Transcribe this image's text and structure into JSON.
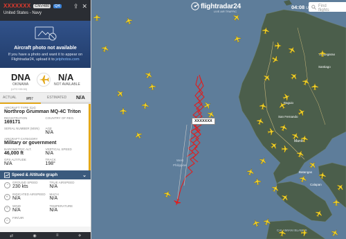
{
  "panel": {
    "callsign": "XXXXXXX",
    "badge_reg": "CNV480",
    "badge_icao": "Q4",
    "airline": "United States - Navy",
    "photo_title": "Aircraft photo not available",
    "photo_text": "If you have a photo and want it to appear on Flightradar24, upload it to",
    "photo_link": "jetphotos.com",
    "origin_code": "DNA",
    "origin_city": "OKINAWA",
    "origin_time": "(UTC+09:00)",
    "dest_code": "N/A",
    "dest_city": "NOT AVAILABLE",
    "actual_label": "ACTUAL",
    "actual_time": "2:37",
    "actual_unit": "am",
    "estimated_label": "ESTIMATED",
    "estimated_value": "N/A",
    "progress": 0.45,
    "aircraft_type_label": "AIRCRAFT TYPE (Q4)",
    "aircraft_type": "Northrop Grumman MQ-4C Triton",
    "registration_label": "REGISTRATION",
    "registration": "169171",
    "country_label": "COUNTRY OF REG.",
    "country_value": "",
    "serial_label": "SERIAL NUMBER (MSN)",
    "serial_value": "",
    "age_label": "AGE",
    "age_value": "N/A",
    "category_label": "AIRCRAFT CATEGORY",
    "category": "Military or government",
    "baro_label": "BAROMETRIC ALT.",
    "baro_value": "46,000 ft",
    "vspeed_label": "VERTICAL SPEED",
    "vspeed_value": "N/A",
    "gps_label": "GPS ALTITUDE",
    "gps_value": "N/A",
    "track_label": "TRACK",
    "track_value": "198°",
    "graph_button": "Speed & Altitude graph",
    "ground_speed_label": "GROUND SPEED",
    "ground_speed": "230 kts",
    "true_airspeed_label": "TRUE AIRSPEED",
    "true_airspeed": "N/A",
    "indicated_label": "INDICATED AIRSPEED",
    "indicated_value": "N/A",
    "mach_label": "MACH",
    "mach_value": "N/A",
    "wind_label": "WIND",
    "wind_value": "N/A",
    "temperature_label": "TEMPERATURE",
    "temperature_value": "N/A",
    "fir_label": "FIR/UIR"
  },
  "header": {
    "logo_name": "flightradar",
    "logo_num": "24",
    "logo_tag": "LIVE AIR TRAFFIC",
    "clock": "04:08",
    "clock_zone": "UTC",
    "search_placeholder": "Find flights"
  },
  "map": {
    "selected_label": "XXXXXXX",
    "places": [
      "Tuguegarao",
      "Santiago",
      "San Fernando",
      "Baguio",
      "Manila",
      "Batangas",
      "Calapan",
      "West Philippine Sea",
      "CALAMIAN ISLANDS"
    ]
  },
  "colors": {
    "sea": "#5e7d9a",
    "land": "#4a5c4a",
    "track": "#e01e1e",
    "aircraft": "#f2d22a",
    "accent": "#e3a81a"
  }
}
